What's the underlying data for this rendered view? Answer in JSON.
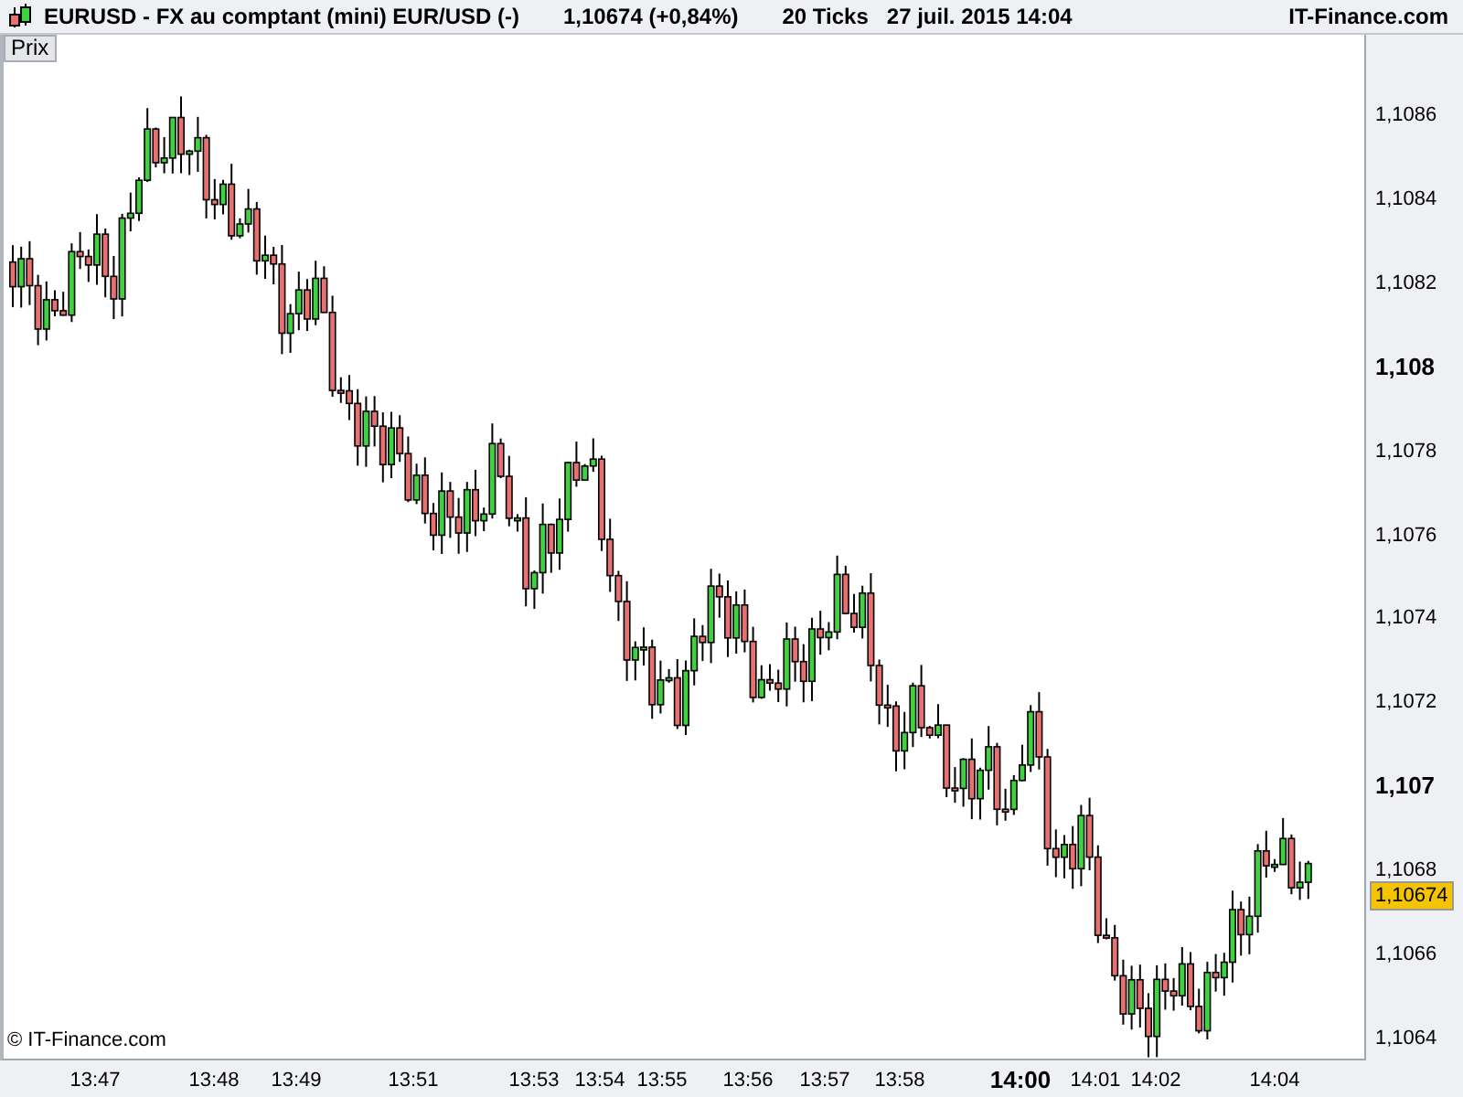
{
  "header": {
    "title": "EURUSD - FX au comptant (mini) EUR/USD (-)",
    "quote": "1,10674 (+0,84%)",
    "interval": "20 Ticks",
    "datetime": "27 juil. 2015 14:04",
    "brand": "IT-Finance.com"
  },
  "tabs": [
    {
      "label": "Prix",
      "selected": true
    }
  ],
  "chart": {
    "credit": "© IT-Finance.com",
    "last_price": "1,10674",
    "y_ticks": [
      {
        "label": "1,1086",
        "major": false
      },
      {
        "label": "1,1084",
        "major": false
      },
      {
        "label": "1,1082",
        "major": false
      },
      {
        "label": "1,108",
        "major": true
      },
      {
        "label": "1,1078",
        "major": false
      },
      {
        "label": "1,1076",
        "major": false
      },
      {
        "label": "1,1074",
        "major": false
      },
      {
        "label": "1,1072",
        "major": false
      },
      {
        "label": "1,107",
        "major": true
      },
      {
        "label": "1,1068",
        "major": false
      },
      {
        "label": "1,1066",
        "major": false
      },
      {
        "label": "1,1064",
        "major": false
      }
    ],
    "x_ticks": [
      {
        "label": "13:47",
        "major": false
      },
      {
        "label": "13:48",
        "major": false
      },
      {
        "label": "13:49",
        "major": false
      },
      {
        "label": "13:51",
        "major": false
      },
      {
        "label": "13:53",
        "major": false
      },
      {
        "label": "13:54",
        "major": false
      },
      {
        "label": "13:55",
        "major": false
      },
      {
        "label": "13:56",
        "major": false
      },
      {
        "label": "13:57",
        "major": false
      },
      {
        "label": "13:58",
        "major": false
      },
      {
        "label": "14:00",
        "major": true
      },
      {
        "label": "14:01",
        "major": false
      },
      {
        "label": "14:02",
        "major": false
      },
      {
        "label": "14:04",
        "major": false
      }
    ]
  }
}
